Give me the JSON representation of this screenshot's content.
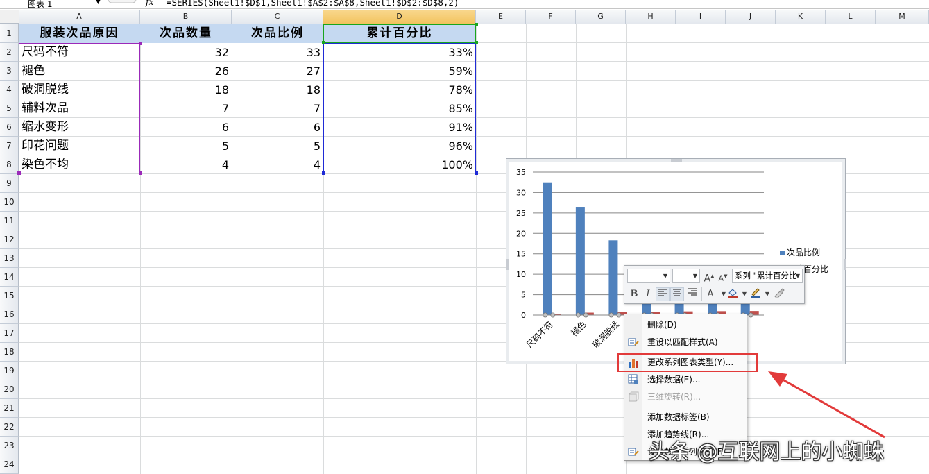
{
  "formula_bar": {
    "name_box": "图表 1",
    "fx": "fx",
    "formula": "=SERIES(Sheet1!$D$1,Sheet1!$A$2:$A$8,Sheet1!$D$2:$D$8,2)"
  },
  "columns": [
    "A",
    "B",
    "C",
    "D",
    "E",
    "F",
    "G",
    "H",
    "I",
    "J",
    "K",
    "L",
    "M"
  ],
  "rows": [
    "1",
    "2",
    "3",
    "4",
    "5",
    "6",
    "7",
    "8",
    "9",
    "10",
    "11",
    "12",
    "13",
    "14",
    "15",
    "16",
    "17",
    "18",
    "19",
    "20",
    "21",
    "22",
    "23",
    "24"
  ],
  "table": {
    "headers": [
      "服装次品原因",
      "次品数量",
      "次品比例",
      "累计百分比"
    ],
    "data": [
      [
        "尺码不符",
        "32",
        "33",
        "33%"
      ],
      [
        "褪色",
        "26",
        "27",
        "59%"
      ],
      [
        "破洞脱线",
        "18",
        "18",
        "78%"
      ],
      [
        "辅料次品",
        "7",
        "7",
        "85%"
      ],
      [
        "缩水变形",
        "6",
        "6",
        "91%"
      ],
      [
        "印花问题",
        "5",
        "5",
        "96%"
      ],
      [
        "染色不均",
        "4",
        "4",
        "100%"
      ]
    ]
  },
  "chart_data": {
    "type": "bar",
    "categories": [
      "尺码不符",
      "褪色",
      "破洞脱线",
      "辅料次品",
      "缩水变形",
      "印花问题",
      "染色不均"
    ],
    "series": [
      {
        "name": "次品比例",
        "values": [
          32.5,
          26.5,
          18.3,
          7,
          6,
          5,
          4
        ],
        "color": "#4f81bd"
      },
      {
        "name": "累计百分比",
        "values": [
          0.33,
          0.59,
          0.78,
          0.85,
          0.91,
          0.96,
          1.0
        ],
        "color": "#c0504d"
      }
    ],
    "yticks": [
      "35",
      "30",
      "25",
      "20",
      "15",
      "10",
      "5",
      "0"
    ],
    "ylim": [
      0,
      35
    ],
    "grid": true,
    "legend": "right",
    "legend_labels": [
      "次品比例",
      "累计百分比"
    ],
    "visible_category_labels": [
      "尺码不符",
      "褪色",
      "破洞脱线"
    ]
  },
  "mini_toolbar": {
    "font_combo": "",
    "size_combo": "",
    "grow_font": "A",
    "shrink_font": "A",
    "series_combo": "系列 \"累计百分比\"",
    "bold": "B",
    "italic": "I",
    "font_color": "A"
  },
  "context_menu": {
    "items": [
      {
        "label": "删除(D)",
        "enabled": true
      },
      {
        "label": "重设以匹配样式(A)",
        "enabled": true
      },
      {
        "label": "更改系列图表类型(Y)...",
        "enabled": true
      },
      {
        "label": "选择数据(E)...",
        "enabled": true
      },
      {
        "label": "三维旋转(R)...",
        "enabled": false
      },
      {
        "label": "添加数据标签(B)",
        "enabled": true
      },
      {
        "label": "添加趋势线(R)...",
        "enabled": true
      },
      {
        "label": "设置数据系列格式(F)...",
        "enabled": true
      }
    ]
  },
  "watermark": "头条 @互联网上的小蜘蛛",
  "colors": {
    "header_fill": "#c5d9f1",
    "bar_blue": "#4f81bd",
    "line_red": "#c0504d",
    "highlight_red": "#e23a3a"
  }
}
